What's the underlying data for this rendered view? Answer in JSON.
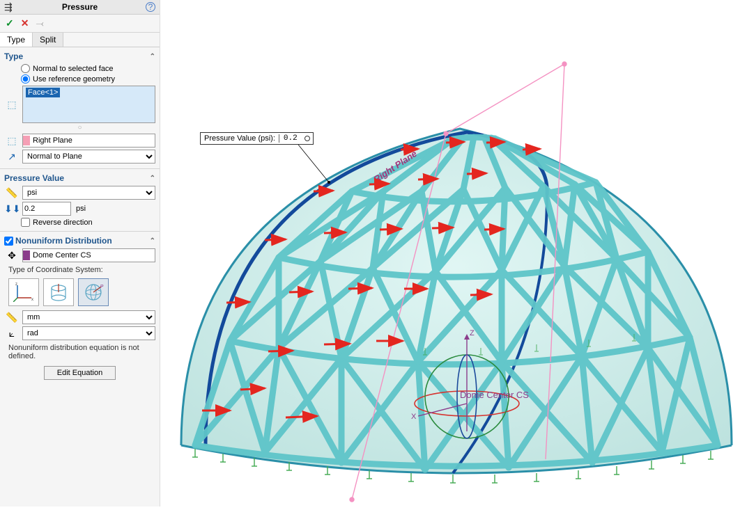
{
  "panel": {
    "title": "Pressure",
    "tabs": {
      "type": "Type",
      "split": "Split"
    }
  },
  "type_section": {
    "header": "Type",
    "opt_normal": "Normal to selected face",
    "opt_refgeom": "Use reference geometry",
    "face_selected": "Face<1>",
    "plane": "Right Plane",
    "direction": "Normal to Plane"
  },
  "pressure_value": {
    "header": "Pressure Value",
    "unit_select": "psi",
    "value": "0.2",
    "value_unit": "psi",
    "reverse": "Reverse direction"
  },
  "nonuniform": {
    "header": "Nonuniform Distribution",
    "cs": "Dome Center CS",
    "cs_label": "Type of Coordinate System:",
    "length_unit": "mm",
    "angle_unit": "rad",
    "note": "Nonuniform distribution equation is not defined.",
    "edit_btn": "Edit Equation"
  },
  "callout": {
    "label": "Pressure Value (psi):",
    "value": "0.2"
  },
  "viewport": {
    "plane_label": "Right Plane",
    "cs_label": "Dome Center CS",
    "z": "Z",
    "x": "X"
  }
}
